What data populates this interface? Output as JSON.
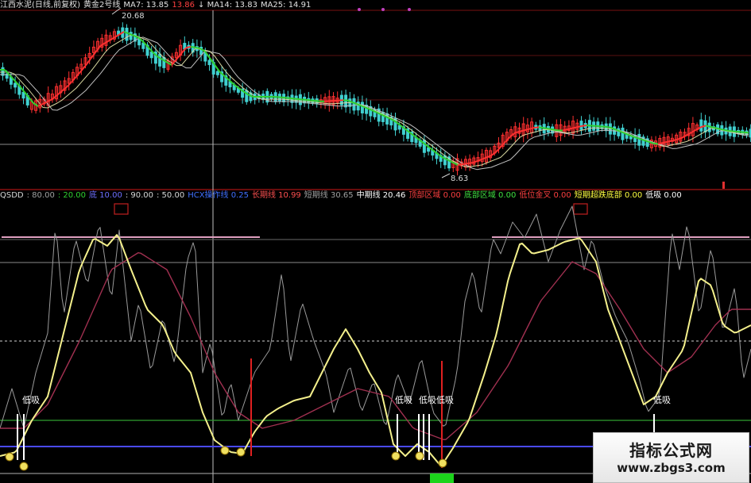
{
  "top_header": [
    {
      "text": "江西水泥(日线,前复权)",
      "color": "#e0e0e0"
    },
    {
      "text": "黄金2号线",
      "color": "#e0e0e0"
    },
    {
      "text": "MA7: 13.85",
      "color": "#e0e0e0"
    },
    {
      "text": "13.86",
      "color": "#ff4040"
    },
    {
      "text": "↓ MA14: 13.83",
      "color": "#e0e0e0"
    },
    {
      "text": "MA25: 14.91",
      "color": "#e0e0e0"
    }
  ],
  "indicator_header": [
    {
      "text": "QSDD",
      "color": "#d8d8d8"
    },
    {
      "text": ": 80.00",
      "color": "#a0a0a0"
    },
    {
      "text": ": 20.00",
      "color": "#30d030"
    },
    {
      "text": "底 10.00",
      "color": "#6f6fff"
    },
    {
      "text": ": 90.00",
      "color": "#d8d8d8"
    },
    {
      "text": ": 50.00",
      "color": "#d8d8d8"
    },
    {
      "text": "HCX操作线 0.25",
      "color": "#4070ff"
    },
    {
      "text": "长期线 10.99",
      "color": "#ff5050"
    },
    {
      "text": "短期线 30.65",
      "color": "#a0a0a0"
    },
    {
      "text": "中期线 20.46",
      "color": "#ffffff"
    },
    {
      "text": "顶部区域 0.00",
      "color": "#ff4040"
    },
    {
      "text": "底部区域 0.00",
      "color": "#40e040"
    },
    {
      "text": "低位金叉 0.00",
      "color": "#ff4040"
    },
    {
      "text": "短期超跌底部 0.00",
      "color": "#ffff40"
    },
    {
      "text": "低吸 0.00",
      "color": "#ffffff"
    }
  ],
  "price_annotations": {
    "high": "20.68",
    "low": "8.63"
  },
  "buy_labels": [
    {
      "text": "低吸"
    },
    {
      "text": "低吸"
    },
    {
      "text": "低吸低吸"
    },
    {
      "text": "低吸"
    }
  ],
  "watermark": {
    "title": "指标公式网",
    "url": "www.zbgs3.com"
  },
  "colors": {
    "background": "#000000",
    "up_candle": "#ff3030",
    "down_candle": "#40d0d0",
    "yellow_line": "#f4f08c",
    "purple_line": "#a03050",
    "gray_line": "#9a9a9a",
    "blue_line": "#4a4aff",
    "green_line": "#30a030",
    "top_line": "#e0a0c0"
  }
}
